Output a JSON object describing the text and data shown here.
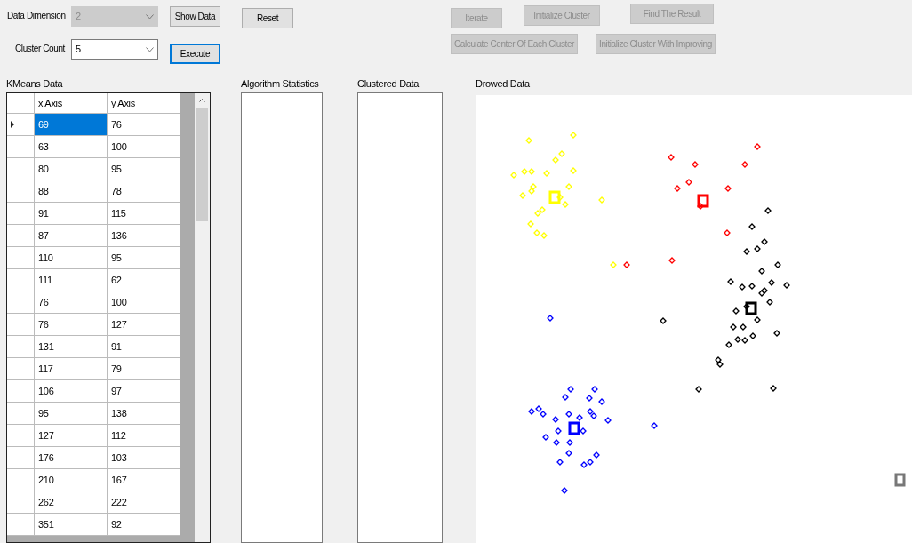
{
  "settings": [
    {
      "label": "Data Dimension",
      "value": "2",
      "disabled": true,
      "button": {
        "label": "Show Data",
        "disabled": false,
        "focused": false
      }
    },
    {
      "label": "Cluster Count",
      "value": "5",
      "disabled": false,
      "button": {
        "label": "Execute",
        "disabled": false,
        "focused": true
      }
    }
  ],
  "reset_button": {
    "label": "Reset",
    "disabled": false
  },
  "algorithm_buttons": [
    [
      {
        "label": "Iterate",
        "disabled": true
      },
      {
        "label": "Initialize Cluster",
        "disabled": true
      },
      {
        "label": "Find The Result",
        "disabled": true
      }
    ],
    [
      {
        "label": "Calculate Center Of Each Cluster",
        "disabled": true
      },
      {
        "label": "Initialize Cluster With Improving",
        "disabled": true
      }
    ]
  ],
  "kmeans_data": {
    "title": "KMeans Data",
    "columns": [
      "x Axis",
      "y Axis"
    ],
    "rows": [
      {
        "cells": [
          "69",
          "76"
        ],
        "selected": true
      },
      {
        "cells": [
          "63",
          "100"
        ],
        "selected": false
      },
      {
        "cells": [
          "80",
          "95"
        ],
        "selected": false
      },
      {
        "cells": [
          "88",
          "78"
        ],
        "selected": false
      },
      {
        "cells": [
          "91",
          "115"
        ],
        "selected": false
      },
      {
        "cells": [
          "87",
          "136"
        ],
        "selected": false
      },
      {
        "cells": [
          "110",
          "95"
        ],
        "selected": false
      },
      {
        "cells": [
          "111",
          "62"
        ],
        "selected": false
      },
      {
        "cells": [
          "76",
          "100"
        ],
        "selected": false
      },
      {
        "cells": [
          "76",
          "127"
        ],
        "selected": false
      },
      {
        "cells": [
          "131",
          "91"
        ],
        "selected": false
      },
      {
        "cells": [
          "117",
          "79"
        ],
        "selected": false
      },
      {
        "cells": [
          "106",
          "97"
        ],
        "selected": false
      },
      {
        "cells": [
          "95",
          "138"
        ],
        "selected": false
      },
      {
        "cells": [
          "127",
          "112"
        ],
        "selected": false
      },
      {
        "cells": [
          "176",
          "103"
        ],
        "selected": false
      },
      {
        "cells": [
          "210",
          "167"
        ],
        "selected": false
      },
      {
        "cells": [
          "262",
          "222"
        ],
        "selected": false
      },
      {
        "cells": [
          "351",
          "92"
        ],
        "selected": false
      }
    ]
  },
  "algorithm_statistics": {
    "title": "Algorithm Statistics"
  },
  "clustered_data": {
    "title": "Clustered Data"
  },
  "drowed_data": {
    "title": "Drowed Data"
  }
}
